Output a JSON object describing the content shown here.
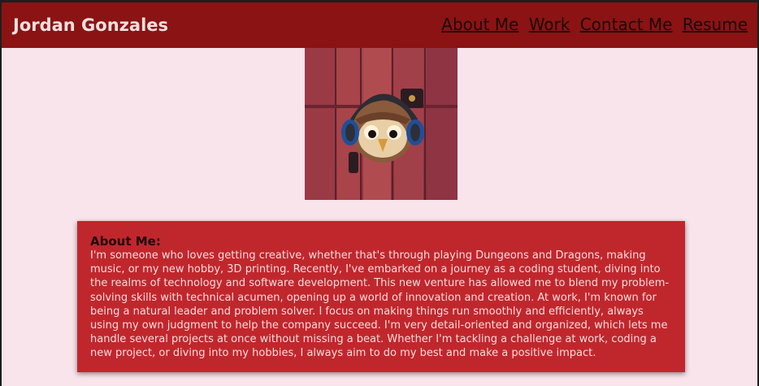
{
  "header": {
    "title": "Jordan Gonzales",
    "nav": [
      "About Me",
      "Work",
      "Contact Me",
      "Resume"
    ]
  },
  "about": {
    "heading": "About Me:",
    "text": "I'm someone who loves getting creative, whether that's through playing Dungeons and Dragons, making music, or my new hobby, 3D printing. Recently, I've embarked on a journey as a coding student, diving into the realms of technology and software development. This new venture has allowed me to blend my problem-solving skills with technical acumen, opening up a world of innovation and creation. At work, I'm known for being a natural leader and problem solver. I focus on making things run smoothly and efficiently, always using my own judgment to help the company succeed. I'm very detail-oriented and organized, which lets me handle several projects at once without missing a beat. Whether I'm tackling a challenge at work, coding a new project, or diving into my hobbies, I always aim to do my best and make a positive impact."
  },
  "colors": {
    "header_bg": "#8b1313",
    "page_bg": "#f9e4ec",
    "card_bg": "#c0272d"
  },
  "icons": [
    "owl-headphones-avatar"
  ]
}
